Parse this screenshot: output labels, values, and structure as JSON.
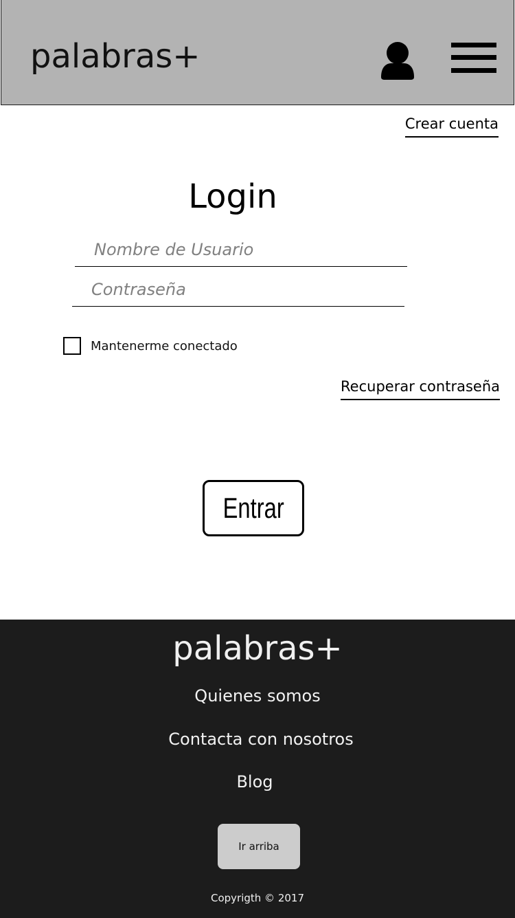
{
  "header": {
    "brand": "palabras+",
    "icons": {
      "user": "user-icon",
      "menu": "hamburger-menu-icon"
    }
  },
  "links": {
    "create_account": "Crear cuenta",
    "recover_password": "Recuperar contraseña"
  },
  "login": {
    "title": "Login",
    "username_placeholder": "Nombre de Usuario",
    "password_placeholder": "Contraseña",
    "remember_label": "Mantenerme conectado",
    "remember_checked": false,
    "submit_label": "Entrar"
  },
  "footer": {
    "brand": "palabras+",
    "links": [
      "Quienes somos",
      "Contacta con nosotros",
      "Blog"
    ],
    "back_to_top": "Ir arriba",
    "copyright": "Copyrigth © 2017"
  },
  "colors": {
    "header_bg": "#b3b3b3",
    "footer_bg": "#1c1c1c",
    "button_light": "#cccccc"
  }
}
